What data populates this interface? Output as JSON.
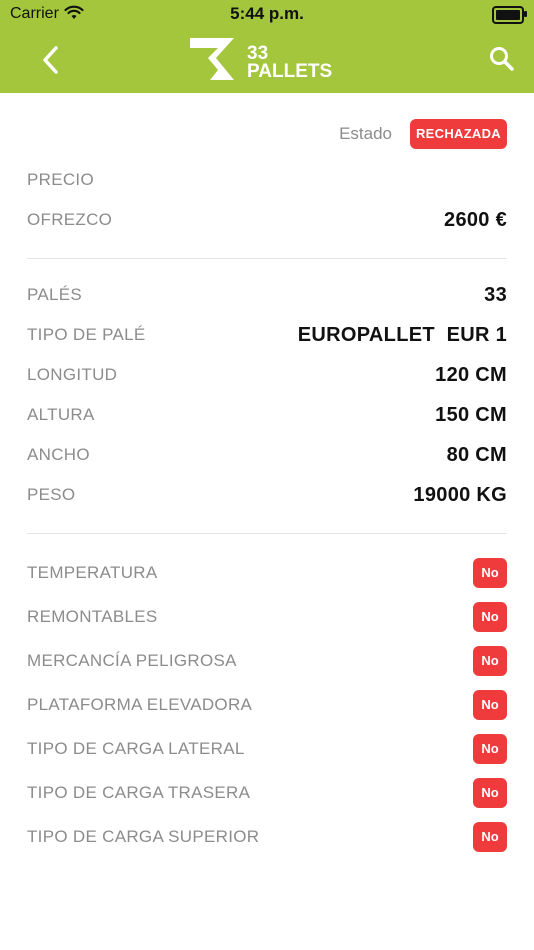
{
  "status_bar": {
    "carrier": "Carrier",
    "time": "5:44 p.m."
  },
  "brand": {
    "logo_text_line1": "33",
    "logo_text_line2": "PALLETS",
    "color": "#a3c63c"
  },
  "estado": {
    "label": "Estado",
    "value": "RECHAZADA",
    "color": "#ef3b3b"
  },
  "precio": {
    "label": "PRECIO"
  },
  "ofrezco": {
    "label": "OFREZCO",
    "value": "2600 €"
  },
  "specs": [
    {
      "label": "PALÉS",
      "value": "33"
    },
    {
      "label": "TIPO DE PALÉ",
      "value": "EUROPALLET  EUR 1"
    },
    {
      "label": "LONGITUD",
      "value": "120 CM"
    },
    {
      "label": "ALTURA",
      "value": "150 CM"
    },
    {
      "label": "ANCHO",
      "value": "80 CM"
    },
    {
      "label": "PESO",
      "value": "19000 KG"
    }
  ],
  "features": [
    {
      "label": "TEMPERATURA",
      "value": "No"
    },
    {
      "label": "REMONTABLES",
      "value": "No"
    },
    {
      "label": "MERCANCÍA PELIGROSA",
      "value": "No"
    },
    {
      "label": "PLATAFORMA ELEVADORA",
      "value": "No"
    },
    {
      "label": "TIPO DE CARGA LATERAL",
      "value": "No"
    },
    {
      "label": "TIPO DE CARGA TRASERA",
      "value": "No"
    },
    {
      "label": "TIPO DE CARGA SUPERIOR",
      "value": "No"
    }
  ],
  "icons": {
    "back": "chevron-left-icon",
    "search": "search-icon",
    "wifi": "wifi-icon",
    "battery": "battery-icon"
  }
}
